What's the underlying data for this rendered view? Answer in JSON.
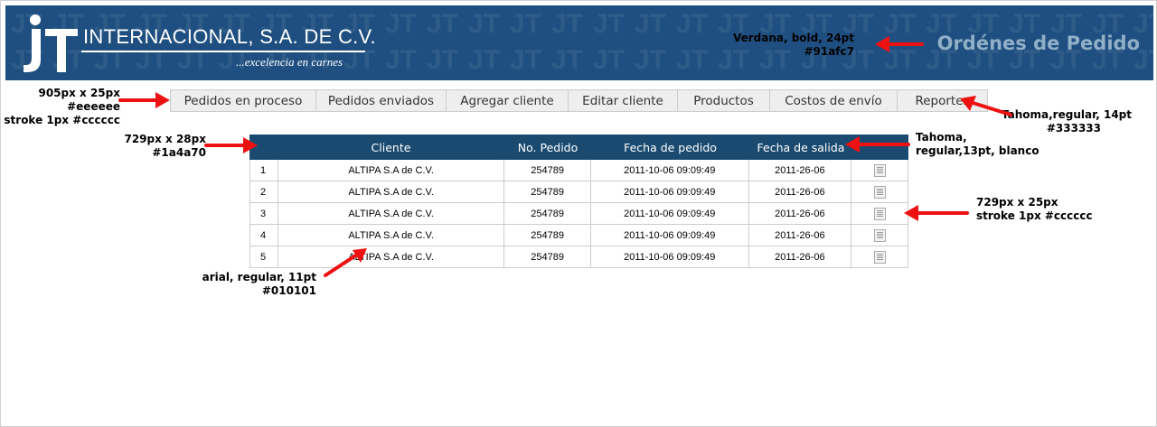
{
  "header": {
    "logo_mark": "JT",
    "company_name": "INTERNACIONAL, S.A. DE C.V.",
    "tagline": "...excelencia en carnes",
    "page_title": "Ordénes de Pedido",
    "title_color": "#91afc7",
    "bg_color": "#1f4f80"
  },
  "nav": {
    "items": [
      {
        "label": "Pedidos en proceso"
      },
      {
        "label": "Pedidos enviados"
      },
      {
        "label": "Agregar cliente"
      },
      {
        "label": "Editar cliente"
      },
      {
        "label": "Productos"
      },
      {
        "label": "Costos de envío"
      },
      {
        "label": "Reportes"
      }
    ]
  },
  "table": {
    "header_bg": "#1a4a70",
    "columns": [
      "",
      "Cliente",
      "No. Pedido",
      "Fecha de pedido",
      "Fecha de salida",
      ""
    ],
    "rows": [
      {
        "n": "1",
        "cliente": "ALTIPA S.A de C.V.",
        "pedido": "254789",
        "fecha_pedido": "2011-10-06 09:09:49",
        "fecha_salida": "2011-26-06",
        "icon": "document-icon"
      },
      {
        "n": "2",
        "cliente": "ALTIPA S.A de C.V.",
        "pedido": "254789",
        "fecha_pedido": "2011-10-06 09:09:49",
        "fecha_salida": "2011-26-06",
        "icon": "document-icon"
      },
      {
        "n": "3",
        "cliente": "ALTIPA S.A de C.V.",
        "pedido": "254789",
        "fecha_pedido": "2011-10-06 09:09:49",
        "fecha_salida": "2011-26-06",
        "icon": "document-icon"
      },
      {
        "n": "4",
        "cliente": "ALTIPA S.A de C.V.",
        "pedido": "254789",
        "fecha_pedido": "2011-10-06 09:09:49",
        "fecha_salida": "2011-26-06",
        "icon": "document-icon"
      },
      {
        "n": "5",
        "cliente": "ALTIPA S.A de C.V.",
        "pedido": "254789",
        "fecha_pedido": "2011-10-06 09:09:49",
        "fecha_salida": "2011-26-06",
        "icon": "document-icon"
      }
    ]
  },
  "annotations": {
    "title_note": [
      "Verdana, bold, 24pt",
      "#91afc7"
    ],
    "nav_note": [
      "905px x 25px",
      "#eeeeee",
      "stroke 1px #cccccc"
    ],
    "nav_font_note": [
      "Tahoma,regular, 14pt",
      "#333333"
    ],
    "header_note": [
      "729px x 28px",
      "#1a4a70"
    ],
    "header_font_note": [
      "Tahoma,",
      "regular,13pt, blanco"
    ],
    "row_note": [
      "729px x 25px",
      "stroke 1px #cccccc"
    ],
    "cell_font_note": [
      "arial, regular, 11pt",
      "#010101"
    ],
    "arrow_color": "#ee1111"
  }
}
